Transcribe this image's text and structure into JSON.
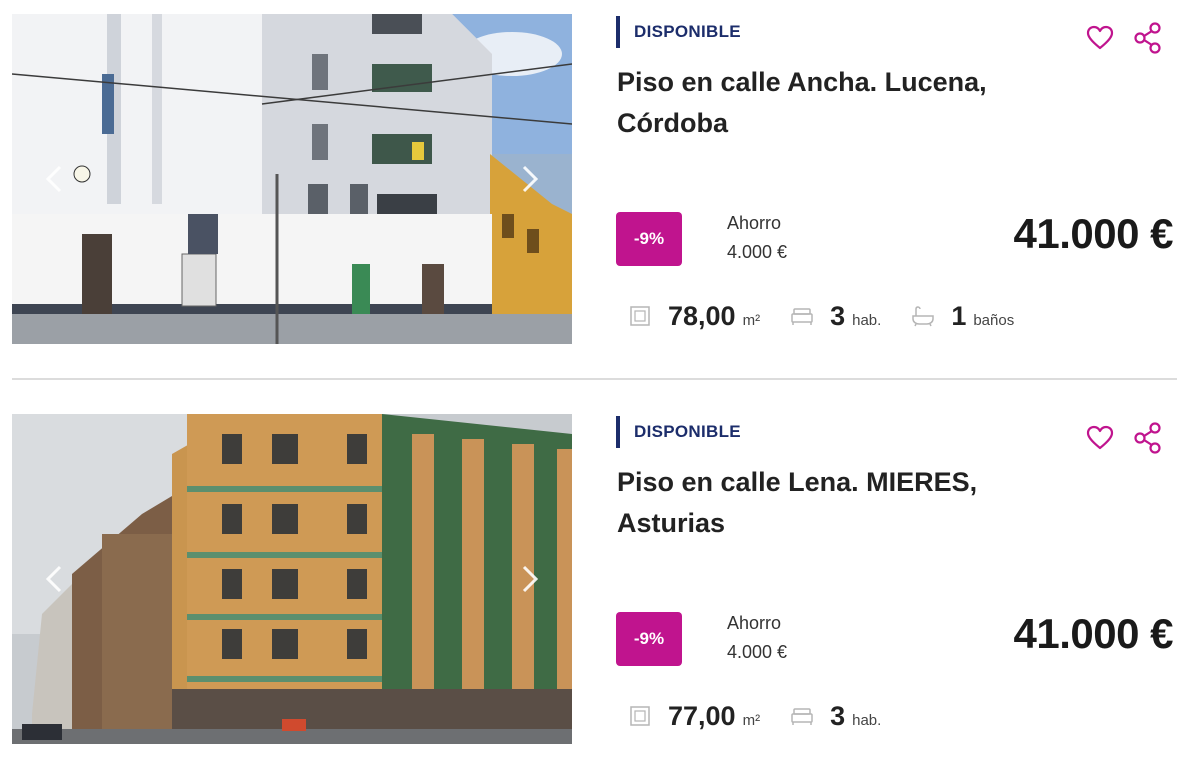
{
  "listings": [
    {
      "status": "DISPONIBLE",
      "title": "Piso en calle Ancha. Lucena, Córdoba",
      "discount": "-9%",
      "savings_label": "Ahorro",
      "savings_amount": "4.000 €",
      "price": "41.000 €",
      "area": "78,00",
      "area_unit": "m²",
      "rooms": "3",
      "rooms_unit": "hab.",
      "baths": "1",
      "baths_unit": "baños"
    },
    {
      "status": "DISPONIBLE",
      "title": "Piso en calle Lena. MIERES, Asturias",
      "discount": "-9%",
      "savings_label": "Ahorro",
      "savings_amount": "4.000 €",
      "price": "41.000 €",
      "area": "77,00",
      "area_unit": "m²",
      "rooms": "3",
      "rooms_unit": "hab."
    }
  ],
  "icons": {
    "favorite": "heart-icon",
    "share": "share-icon",
    "area": "area-icon",
    "rooms": "bed-icon",
    "baths": "bathtub-icon",
    "prev": "chevron-left-icon",
    "next": "chevron-right-icon"
  },
  "colors": {
    "accent": "#c0148e",
    "status": "#1c2d6b",
    "icon_pink": "#c0148e"
  }
}
